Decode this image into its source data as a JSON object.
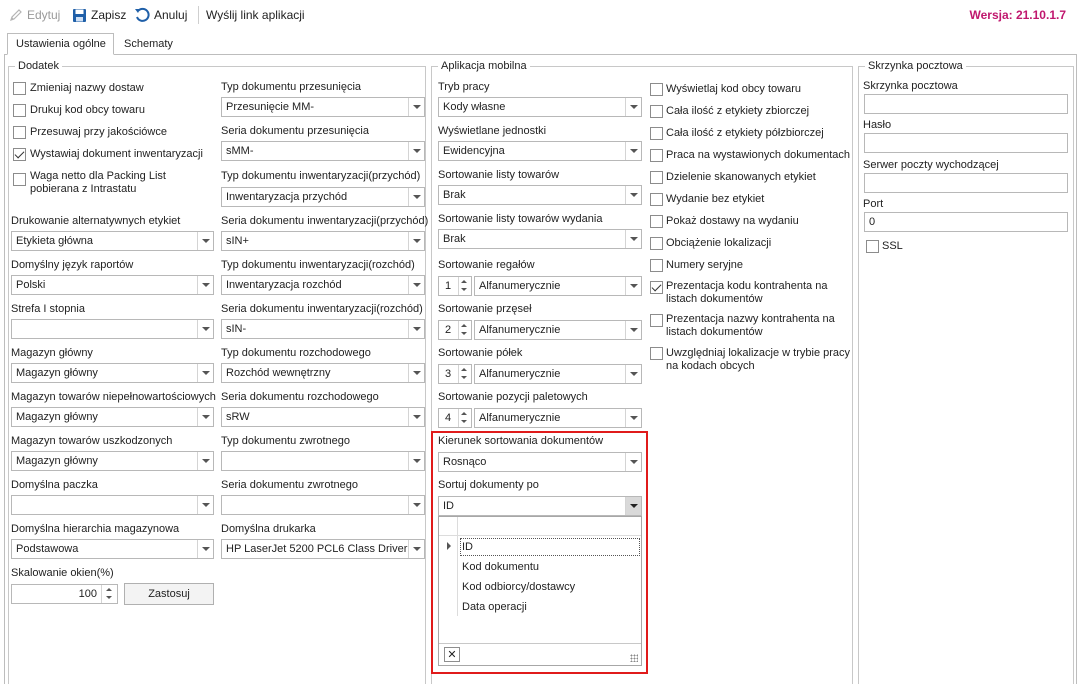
{
  "toolbar": {
    "edit": "Edytuj",
    "save": "Zapisz",
    "cancel": "Anuluj",
    "send_link": "Wyślij link aplikacji",
    "version": "Wersja: 21.10.1.7"
  },
  "tabs": [
    {
      "label": "Ustawienia ogólne",
      "active": true
    },
    {
      "label": "Schematy",
      "active": false
    }
  ],
  "dodatek": {
    "title": "Dodatek",
    "checkboxes": [
      {
        "label": "Zmieniaj nazwy dostaw",
        "checked": false
      },
      {
        "label": "Drukuj kod obcy towaru",
        "checked": false
      },
      {
        "label": "Przesuwaj przy jakościówce",
        "checked": false
      },
      {
        "label": "Wystawiaj dokument inwentaryzacji",
        "checked": true
      },
      {
        "label": "Waga netto dla Packing List pobierana z Intrastatu",
        "checked": false
      }
    ],
    "left_fields": [
      {
        "label": "Drukowanie alternatywnych etykiet",
        "value": "Etykieta główna"
      },
      {
        "label": "Domyślny język raportów",
        "value": "Polski"
      },
      {
        "label": "Strefa I stopnia",
        "value": ""
      },
      {
        "label": "Magazyn główny",
        "value": "Magazyn główny"
      },
      {
        "label": "Magazyn towarów niepełnowartościowych",
        "value": "Magazyn główny"
      },
      {
        "label": "Magazyn towarów uszkodzonych",
        "value": "Magazyn główny"
      },
      {
        "label": "Domyślna paczka",
        "value": ""
      },
      {
        "label": "Domyślna hierarchia magazynowa",
        "value": "Podstawowa"
      }
    ],
    "right_fields": [
      {
        "label": "Typ dokumentu przesunięcia",
        "value": "Przesunięcie MM-"
      },
      {
        "label": "Seria dokumentu przesunięcia",
        "value": "sMM-"
      },
      {
        "label": "Typ dokumentu inwentaryzacji(przychód)",
        "value": "Inwentaryzacja przychód"
      },
      {
        "label": "Seria dokumentu inwentaryzacji(przychód)",
        "value": "sIN+"
      },
      {
        "label": "Typ dokumentu inwentaryzacji(rozchód)",
        "value": "Inwentaryzacja rozchód"
      },
      {
        "label": "Seria dokumentu inwentaryzacji(rozchód)",
        "value": "sIN-"
      },
      {
        "label": "Typ dokumentu rozchodowego",
        "value": "Rozchód wewnętrzny"
      },
      {
        "label": "Seria dokumentu rozchodowego",
        "value": "sRW"
      },
      {
        "label": "Typ dokumentu zwrotnego",
        "value": ""
      },
      {
        "label": "Seria dokumentu zwrotnego",
        "value": ""
      },
      {
        "label": "Domyślna drukarka",
        "value": "HP LaserJet 5200 PCL6 Class Driver"
      }
    ],
    "scaling_label": "Skalowanie okien(%)",
    "scaling_value": "100",
    "apply_button": "Zastosuj"
  },
  "mobile": {
    "title": "Aplikacja mobilna",
    "fields": [
      {
        "label": "Tryb pracy",
        "value": "Kody własne"
      },
      {
        "label": "Wyświetlane jednostki",
        "value": "Ewidencyjna"
      },
      {
        "label": "Sortowanie listy towarów",
        "value": "Brak"
      },
      {
        "label": "Sortowanie listy towarów wydania",
        "value": "Brak"
      }
    ],
    "sort_fields": [
      {
        "label": "Sortowanie regałów",
        "num": "1",
        "value": "Alfanumerycznie"
      },
      {
        "label": "Sortowanie przęseł",
        "num": "2",
        "value": "Alfanumerycznie"
      },
      {
        "label": "Sortowanie półek",
        "num": "3",
        "value": "Alfanumerycznie"
      },
      {
        "label": "Sortowanie pozycji paletowych",
        "num": "4",
        "value": "Alfanumerycznie"
      }
    ],
    "doc_sort_direction_label": "Kierunek sortowania dokumentów",
    "doc_sort_direction_value": "Rosnąco",
    "doc_sort_by_label": "Sortuj dokumenty po",
    "doc_sort_by_value": "ID",
    "doc_sort_options": [
      "ID",
      "Kod dokumentu",
      "Kod odbiorcy/dostawcy",
      "Data operacji"
    ],
    "close_symbol": "✕",
    "checkboxes": [
      {
        "label": "Wyświetlaj kod obcy towaru",
        "checked": false
      },
      {
        "label": "Cała ilość z etykiety zbiorczej",
        "checked": false
      },
      {
        "label": "Cała ilość z etykiety półzbiorczej",
        "checked": false
      },
      {
        "label": "Praca na wystawionych dokumentach",
        "checked": false
      },
      {
        "label": "Dzielenie skanowanych etykiet",
        "checked": false
      },
      {
        "label": "Wydanie bez etykiet",
        "checked": false
      },
      {
        "label": "Pokaż dostawy na wydaniu",
        "checked": false
      },
      {
        "label": "Obciążenie lokalizacji",
        "checked": false
      },
      {
        "label": "Numery seryjne",
        "checked": false
      },
      {
        "label": "Prezentacja kodu kontrahenta na listach dokumentów",
        "checked": true
      },
      {
        "label": "Prezentacja nazwy kontrahenta na listach dokumentów",
        "checked": false
      },
      {
        "label": "Uwzględniaj lokalizacje w trybie pracy na kodach obcych",
        "checked": false
      }
    ]
  },
  "mailbox": {
    "title": "Skrzynka pocztowa",
    "fields": [
      {
        "label": "Skrzynka pocztowa",
        "value": ""
      },
      {
        "label": "Hasło",
        "value": ""
      },
      {
        "label": "Serwer poczty wychodzącej",
        "value": ""
      },
      {
        "label": "Port",
        "value": "0"
      }
    ],
    "ssl_label": "SSL",
    "ssl_checked": false
  }
}
